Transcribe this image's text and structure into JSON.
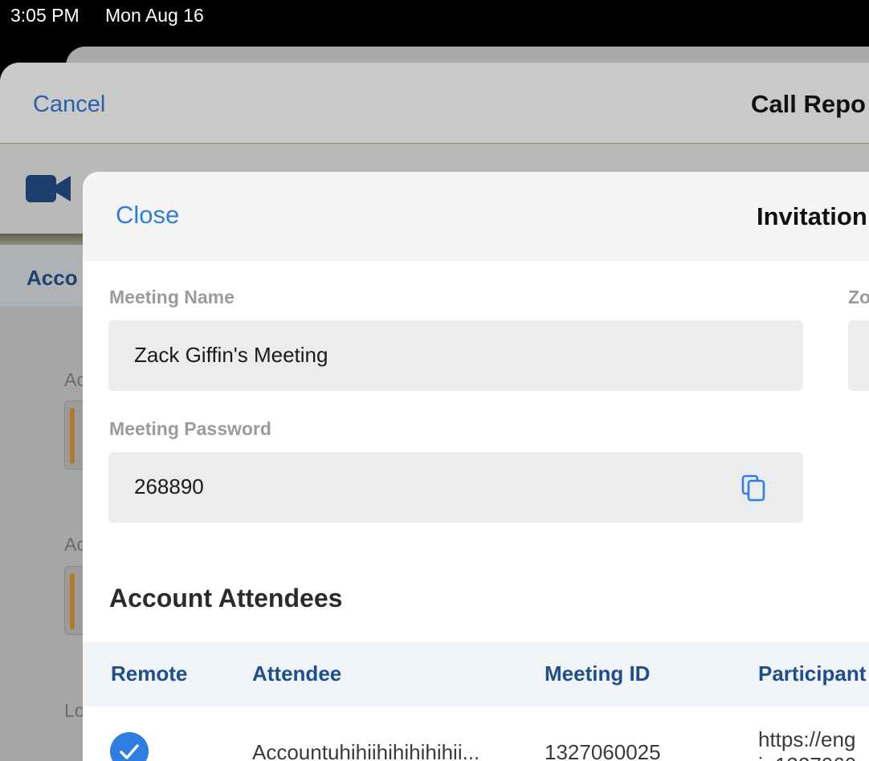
{
  "status_bar": {
    "time": "3:05 PM",
    "date": "Mon Aug 16"
  },
  "call_report_sheet": {
    "cancel_label": "Cancel",
    "title": "Call Repo",
    "tab_label": "Acco",
    "fragments": [
      "Ac",
      "Ac",
      "Lo"
    ]
  },
  "invitation_sheet": {
    "close_label": "Close",
    "title": "Invitation",
    "meeting_name_label": "Meeting Name",
    "meeting_name_value": "Zack Giffin's Meeting",
    "right_label_fragment": "Zo",
    "meeting_password_label": "Meeting Password",
    "meeting_password_value": "268890",
    "section_title": "Account Attendees",
    "table": {
      "headers": [
        "Remote",
        "Attendee",
        "Meeting ID",
        "Participant"
      ],
      "rows": [
        {
          "remote_checked": true,
          "attendee": "Accountuhihiihihihihihii...",
          "meeting_id": "1327060025",
          "participant_line1": "https://eng",
          "participant_line2": "i=1327060"
        }
      ]
    }
  },
  "colors": {
    "accent": "#2f7de1",
    "header_text": "#1e4f8a",
    "cancel_blue": "#2a5fae",
    "video_icon": "#1c3f6e"
  }
}
